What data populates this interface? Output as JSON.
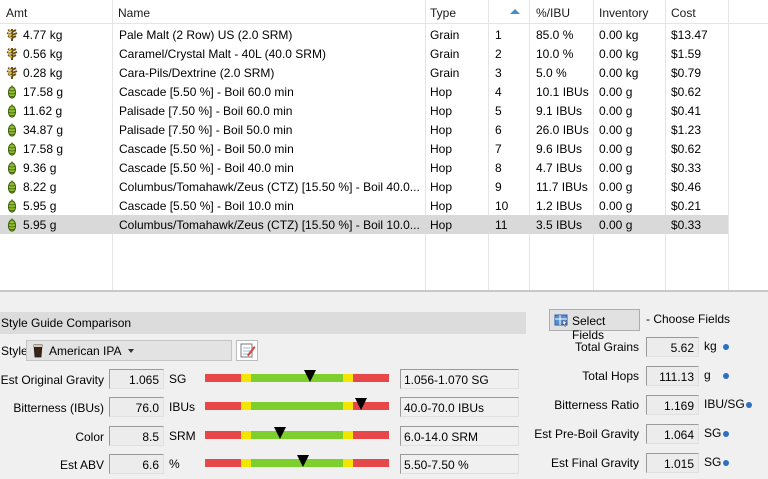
{
  "grid": {
    "headers": {
      "amt": "Amt",
      "name": "Name",
      "type": "Type",
      "pct": "%/IBU",
      "inventory": "Inventory",
      "cost": "Cost"
    },
    "rows": [
      {
        "icon": "grain-icon",
        "amt": "4.77 kg",
        "name": "Pale Malt (2 Row) US (2.0 SRM)",
        "type": "Grain",
        "num": "1",
        "pct": "85.0 %",
        "inventory": "0.00 kg",
        "cost": "$13.47"
      },
      {
        "icon": "grain-icon",
        "amt": "0.56 kg",
        "name": "Caramel/Crystal Malt - 40L (40.0 SRM)",
        "type": "Grain",
        "num": "2",
        "pct": "10.0 %",
        "inventory": "0.00 kg",
        "cost": "$1.59"
      },
      {
        "icon": "grain-icon",
        "amt": "0.28 kg",
        "name": "Cara-Pils/Dextrine (2.0 SRM)",
        "type": "Grain",
        "num": "3",
        "pct": "5.0 %",
        "inventory": "0.00 kg",
        "cost": "$0.79"
      },
      {
        "icon": "hop-icon",
        "amt": "17.58 g",
        "name": "Cascade [5.50 %] - Boil 60.0 min",
        "type": "Hop",
        "num": "4",
        "pct": "10.1 IBUs",
        "inventory": "0.00 g",
        "cost": "$0.62"
      },
      {
        "icon": "hop-icon",
        "amt": "11.62 g",
        "name": "Palisade [7.50 %] - Boil 60.0 min",
        "type": "Hop",
        "num": "5",
        "pct": "9.1 IBUs",
        "inventory": "0.00 g",
        "cost": "$0.41"
      },
      {
        "icon": "hop-icon",
        "amt": "34.87 g",
        "name": "Palisade [7.50 %] - Boil 50.0 min",
        "type": "Hop",
        "num": "6",
        "pct": "26.0 IBUs",
        "inventory": "0.00 g",
        "cost": "$1.23"
      },
      {
        "icon": "hop-icon",
        "amt": "17.58 g",
        "name": "Cascade [5.50 %] - Boil 50.0 min",
        "type": "Hop",
        "num": "7",
        "pct": "9.6 IBUs",
        "inventory": "0.00 g",
        "cost": "$0.62"
      },
      {
        "icon": "hop-icon",
        "amt": "9.36 g",
        "name": "Cascade [5.50 %] - Boil 40.0 min",
        "type": "Hop",
        "num": "8",
        "pct": "4.7 IBUs",
        "inventory": "0.00 g",
        "cost": "$0.33"
      },
      {
        "icon": "hop-icon",
        "amt": "8.22 g",
        "name": "Columbus/Tomahawk/Zeus (CTZ) [15.50 %] - Boil 40.0...",
        "type": "Hop",
        "num": "9",
        "pct": "11.7 IBUs",
        "inventory": "0.00 g",
        "cost": "$0.46"
      },
      {
        "icon": "hop-icon",
        "amt": "5.95 g",
        "name": "Cascade [5.50 %] - Boil 10.0 min",
        "type": "Hop",
        "num": "10",
        "pct": "1.2 IBUs",
        "inventory": "0.00 g",
        "cost": "$0.21"
      },
      {
        "icon": "hop-icon",
        "amt": "5.95 g",
        "name": "Columbus/Tomahawk/Zeus (CTZ) [15.50 %] - Boil 10.0...",
        "type": "Hop",
        "num": "11",
        "pct": "3.5 IBUs",
        "inventory": "0.00 g",
        "cost": "$0.33",
        "selected": true
      }
    ]
  },
  "style_guide": {
    "header": "Style Guide Comparison",
    "style_label": "Style",
    "style_value": "American IPA",
    "params": [
      {
        "label": "Est Original Gravity",
        "value": "1.065",
        "unit": "SG",
        "range": "1.056-1.070 SG",
        "marker_fraction": 0.57
      },
      {
        "label": "Bitterness (IBUs)",
        "value": "76.0",
        "unit": "IBUs",
        "range": "40.0-70.0 IBUs",
        "marker_fraction": 0.85
      },
      {
        "label": "Color",
        "value": "8.5",
        "unit": "SRM",
        "range": "6.0-14.0 SRM",
        "marker_fraction": 0.41
      },
      {
        "label": "Est ABV",
        "value": "6.6",
        "unit": "%",
        "range": "5.50-7.50 %",
        "marker_fraction": 0.53
      }
    ],
    "bar_colors": {
      "red": "#e8474a",
      "yellow": "#f2e600",
      "green": "#7ccf2c"
    }
  },
  "fields": {
    "select_button": "Select Fields",
    "choose_label": "- Choose Fields",
    "items": [
      {
        "label": "Total Grains",
        "value": "5.62",
        "unit": "kg"
      },
      {
        "label": "Total Hops",
        "value": "111.13",
        "unit": "g"
      },
      {
        "label": "Bitterness Ratio",
        "value": "1.169",
        "unit": "IBU/SG"
      },
      {
        "label": "Est Pre-Boil Gravity",
        "value": "1.064",
        "unit": "SG"
      },
      {
        "label": "Est Final Gravity",
        "value": "1.015",
        "unit": "SG"
      }
    ]
  }
}
